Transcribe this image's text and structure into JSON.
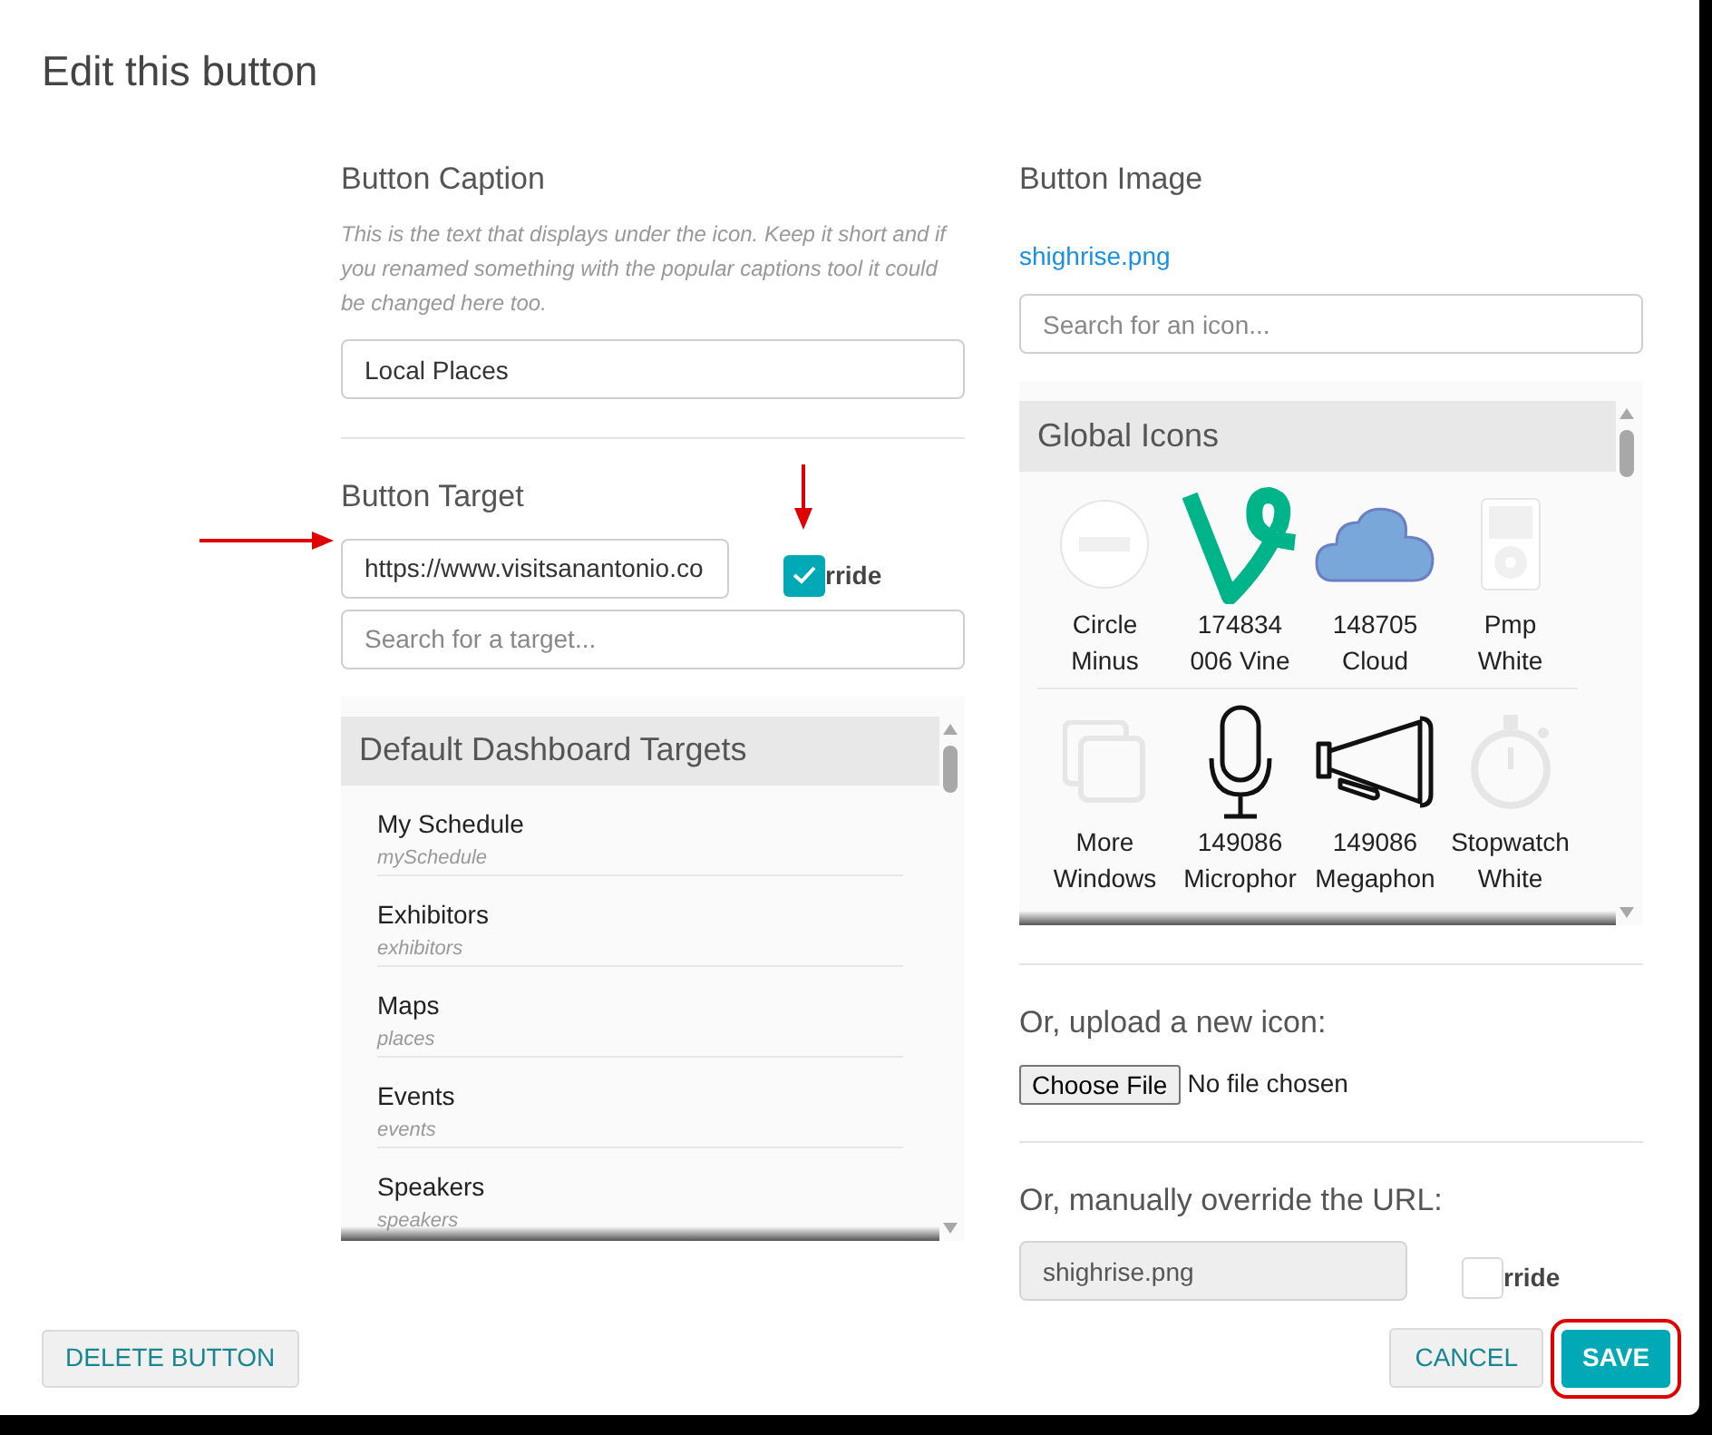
{
  "dialog": {
    "title": "Edit this button"
  },
  "caption": {
    "heading": "Button Caption",
    "help": "This is the text that displays under the icon. Keep it short and if you renamed something with the popular captions tool it could be changed here too.",
    "value": "Local Places"
  },
  "target": {
    "heading": "Button Target",
    "value": "https://www.visitsanantonio.co",
    "override": {
      "label": "rride",
      "checked": true
    },
    "search": {
      "placeholder": "Search for a target..."
    },
    "list": {
      "header": "Default Dashboard Targets",
      "items": [
        {
          "title": "My Schedule",
          "slug": "mySchedule"
        },
        {
          "title": "Exhibitors",
          "slug": "exhibitors"
        },
        {
          "title": "Maps",
          "slug": "places"
        },
        {
          "title": "Events",
          "slug": "events"
        },
        {
          "title": "Speakers",
          "slug": "speakers"
        }
      ]
    }
  },
  "image": {
    "heading": "Button Image",
    "filename": "shighrise.png",
    "search": {
      "placeholder": "Search for an icon..."
    },
    "icons": {
      "header": "Global Icons",
      "items": [
        {
          "kind": "circle-minus",
          "line1": "Circle",
          "line2": "Minus"
        },
        {
          "kind": "vine",
          "line1": "174834",
          "line2": "006 Vine"
        },
        {
          "kind": "cloud",
          "line1": "148705",
          "line2": "Cloud"
        },
        {
          "kind": "player",
          "line1": "Pmp",
          "line2": "White"
        },
        {
          "kind": "windows",
          "line1": "More",
          "line2": "Windows"
        },
        {
          "kind": "microphone",
          "line1": "149086",
          "line2": "Microphor"
        },
        {
          "kind": "megaphone",
          "line1": "149086",
          "line2": "Megaphon"
        },
        {
          "kind": "stopwatch",
          "line1": "Stopwatch",
          "line2": "White"
        }
      ]
    },
    "upload": {
      "label": "Or, upload a new icon:",
      "button": "Choose File",
      "status": "No file chosen"
    },
    "manual": {
      "label": "Or, manually override the URL:",
      "value": "shighrise.png",
      "override": {
        "label": "rride",
        "checked": false
      }
    }
  },
  "buttons": {
    "delete": "DELETE BUTTON",
    "cancel": "CANCEL",
    "save": "SAVE"
  }
}
